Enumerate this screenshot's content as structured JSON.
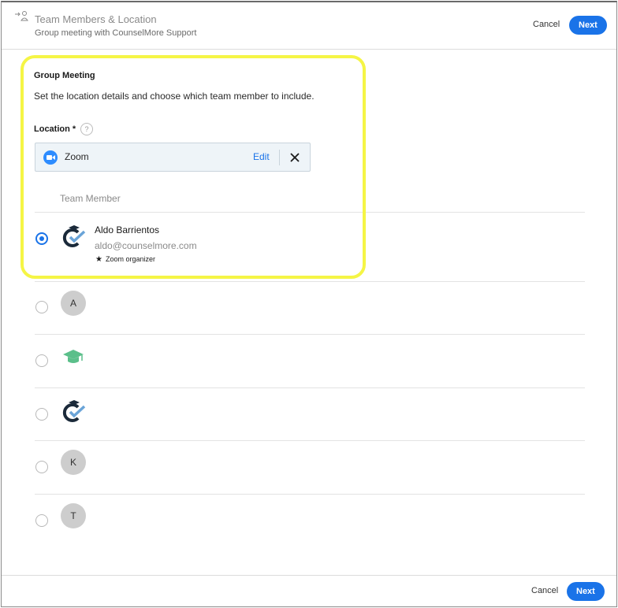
{
  "header": {
    "title": "Team Members & Location",
    "subtitle": "Group meeting with CounselMore Support",
    "cancel_label": "Cancel",
    "next_label": "Next"
  },
  "section": {
    "title": "Group Meeting",
    "description": "Set the location details and choose which team member to include."
  },
  "location": {
    "label": "Location *",
    "help": "?",
    "value": "Zoom",
    "icon": "zoom-icon",
    "edit_label": "Edit",
    "remove_icon": "close-icon"
  },
  "team": {
    "column_header": "Team Member",
    "members": [
      {
        "name": "Aldo Barrientos",
        "email": "aldo@counselmore.com",
        "badge": "Zoom organizer",
        "selected": true,
        "avatar": "counselmore-logo"
      },
      {
        "initial": "A",
        "selected": false
      },
      {
        "avatar": "graduation-cap-logo",
        "selected": false
      },
      {
        "avatar": "counselmore-logo",
        "selected": false
      },
      {
        "initial": "K",
        "selected": false
      },
      {
        "initial": "T",
        "selected": false
      }
    ]
  },
  "footer": {
    "cancel_label": "Cancel",
    "next_label": "Next"
  },
  "colors": {
    "accent": "#1a73e8",
    "highlight": "#f5f545",
    "zoom": "#2d8cff"
  }
}
